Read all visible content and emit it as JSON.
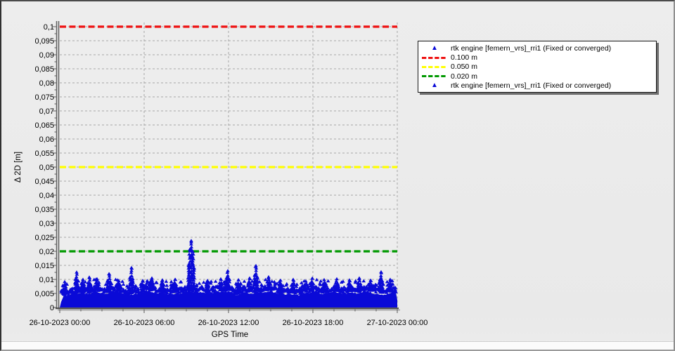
{
  "window": {
    "background": "#ebebeb"
  },
  "colors": {
    "plot_bg": "#ededed",
    "grid": "#a6a6a6",
    "axis_dark": "#5f5f5f",
    "axis_shadow": "#a0a0a0",
    "tick": "#5a5a5a",
    "series_blue": "#0a0ad7",
    "ref_red": "#ee1111",
    "ref_yellow": "#ffff00",
    "ref_green": "#009900",
    "legend_shadow": "#6f6f6f"
  },
  "chart_data": {
    "type": "scatter",
    "title": "",
    "xlabel": "GPS Time",
    "ylabel": "Δ 2D [m]",
    "grid": {
      "style": "dashed",
      "h_step_m": 0.005,
      "v_step_hours": 6
    },
    "x_axis": {
      "start": "26-10-2023 00:00",
      "end": "27-10-2023 00:00",
      "span_hours": 24,
      "major_tick_hours": 6,
      "minor_tick_hours": 1.5,
      "tick_labels": [
        "26-10-2023 00:00",
        "26-10-2023 06:00",
        "26-10-2023 12:00",
        "26-10-2023 18:00",
        "27-10-2023 00:00"
      ]
    },
    "y_axis": {
      "min": 0,
      "max": 0.1,
      "tick_step": 0.005,
      "minor_tick_step": 0.0025,
      "decimal_separator": ",",
      "tick_labels": [
        "0,1",
        "0,095",
        "0,09",
        "0,085",
        "0,08",
        "0,075",
        "0,07",
        "0,065",
        "0,06",
        "0,055",
        "0,05",
        "0,045",
        "0,04",
        "0,035",
        "0,03",
        "0,025",
        "0,02",
        "0,015",
        "0,01",
        "0,005",
        "0"
      ]
    },
    "reference_lines": [
      {
        "label": "0.100 m",
        "value": 0.1,
        "color": "#ee1111"
      },
      {
        "label": "0.050 m",
        "value": 0.05,
        "color": "#ffff00"
      },
      {
        "label": "0.020 m",
        "value": 0.02,
        "color": "#009900"
      }
    ],
    "series": [
      {
        "name": "rtk engine [femern_vrs]_rri1 (Fixed or converged)",
        "marker": "triangle",
        "color": "#0a0ad7",
        "description": "dense noise band of fixed/converged RTK 2D deltas",
        "baseline_band_m": [
          0,
          0.008
        ],
        "max_value_m": 0.0238,
        "max_at": "26-10-2023 ~09:20",
        "peaks": [
          {
            "hours": 0.35,
            "value": 0.0092
          },
          {
            "hours": 1.2,
            "value": 0.0126
          },
          {
            "hours": 1.65,
            "value": 0.01
          },
          {
            "hours": 2.1,
            "value": 0.0108
          },
          {
            "hours": 2.65,
            "value": 0.0102
          },
          {
            "hours": 3.5,
            "value": 0.012
          },
          {
            "hours": 4.2,
            "value": 0.0095
          },
          {
            "hours": 5.1,
            "value": 0.0142
          },
          {
            "hours": 5.9,
            "value": 0.0096
          },
          {
            "hours": 6.55,
            "value": 0.0105
          },
          {
            "hours": 7.3,
            "value": 0.0098
          },
          {
            "hours": 8.2,
            "value": 0.01
          },
          {
            "hours": 9.35,
            "value": 0.0238
          },
          {
            "hours": 10.5,
            "value": 0.0096
          },
          {
            "hours": 11.45,
            "value": 0.0102
          },
          {
            "hours": 11.95,
            "value": 0.0131
          },
          {
            "hours": 12.7,
            "value": 0.0098
          },
          {
            "hours": 13.5,
            "value": 0.0105
          },
          {
            "hours": 13.95,
            "value": 0.0149
          },
          {
            "hours": 14.85,
            "value": 0.0109
          },
          {
            "hours": 15.7,
            "value": 0.0097
          },
          {
            "hours": 16.6,
            "value": 0.01
          },
          {
            "hours": 17.5,
            "value": 0.0094
          },
          {
            "hours": 17.95,
            "value": 0.0104
          },
          {
            "hours": 18.8,
            "value": 0.0099
          },
          {
            "hours": 19.7,
            "value": 0.0102
          },
          {
            "hours": 20.6,
            "value": 0.0098
          },
          {
            "hours": 21.3,
            "value": 0.0105
          },
          {
            "hours": 22.1,
            "value": 0.0097
          },
          {
            "hours": 22.85,
            "value": 0.0127
          },
          {
            "hours": 23.5,
            "value": 0.01
          }
        ]
      }
    ],
    "legend": {
      "items": [
        {
          "marker": "triangle",
          "color": "#0a0ad7",
          "label": "rtk engine [femern_vrs]_rri1 (Fixed or converged)"
        },
        {
          "marker": "dash",
          "color": "#ee1111",
          "label": "0.100 m"
        },
        {
          "marker": "dash",
          "color": "#ffff00",
          "label": "0.050 m"
        },
        {
          "marker": "dash",
          "color": "#009900",
          "label": "0.020 m"
        },
        {
          "marker": "triangle",
          "color": "#0a0ad7",
          "label": "rtk engine [femern_vrs]_rri1 (Fixed or converged)"
        }
      ]
    }
  }
}
